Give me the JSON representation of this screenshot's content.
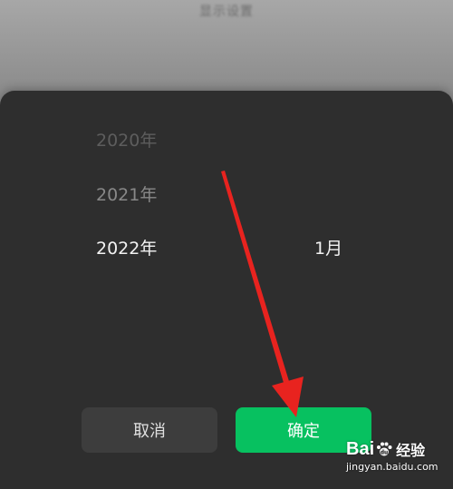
{
  "background": {
    "title": "显示设置"
  },
  "picker": {
    "years": [
      "2020年",
      "2021年",
      "2022年"
    ],
    "selected_year": "2022年",
    "months": [
      "1月"
    ],
    "selected_month": "1月"
  },
  "buttons": {
    "cancel_label": "取消",
    "confirm_label": "确定"
  },
  "annotation": {
    "arrow_color": "#e8231f",
    "points_to": "confirm-button"
  },
  "watermark": {
    "brand_left": "Bai",
    "brand_right": "du",
    "product": "经验",
    "url": "jingyan.baidu.com"
  },
  "colors": {
    "sheet_bg": "#2e2e2e",
    "confirm_green": "#07c160",
    "cancel_bg": "#3d3d3d"
  }
}
